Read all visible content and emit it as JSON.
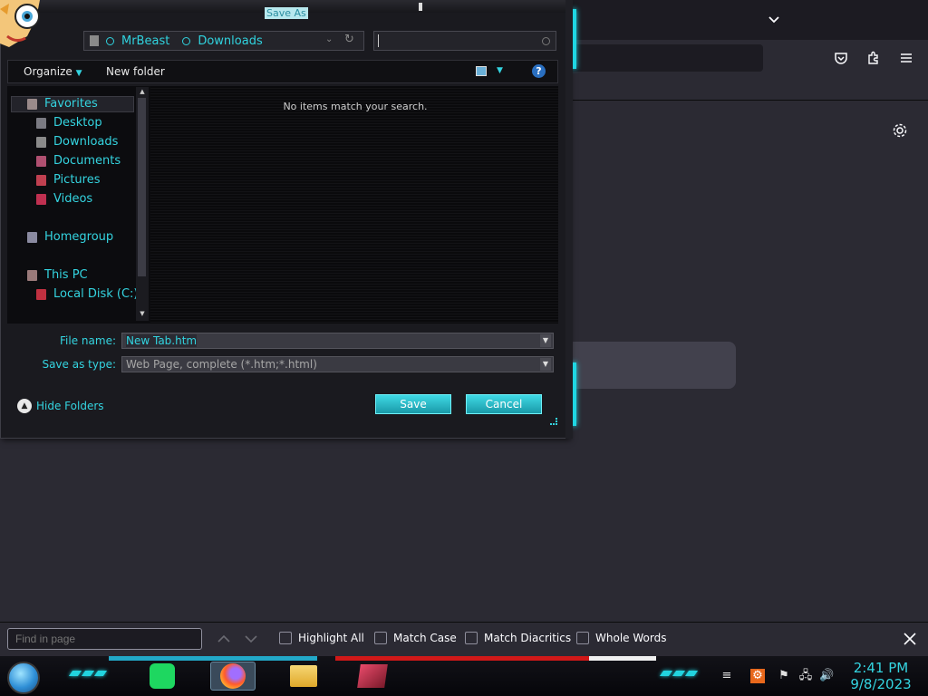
{
  "dialog": {
    "title": "Save As",
    "breadcrumb": [
      "MrBeast",
      "Downloads"
    ],
    "toolbar": {
      "organize": "Organize",
      "new_folder": "New folder"
    },
    "nav": {
      "favorites": "Favorites",
      "items": [
        "Desktop",
        "Downloads",
        "Documents",
        "Pictures",
        "Videos"
      ],
      "homegroup": "Homegroup",
      "this_pc": "This PC",
      "local_disk": "Local Disk (C:)"
    },
    "empty_message": "No items match your search.",
    "file_name_label": "File name:",
    "file_name_value": "New Tab.htm",
    "save_as_type_label": "Save as type:",
    "save_as_type_value": "Web Page, complete (*.htm;*.html)",
    "hide_folders": "Hide Folders",
    "save_button": "Save",
    "cancel_button": "Cancel"
  },
  "findbar": {
    "placeholder": "Find in page",
    "highlight_all": "Highlight All",
    "match_case": "Match Case",
    "match_diacritics": "Match Diacritics",
    "whole_words": "Whole Words"
  },
  "taskbar": {
    "time": "2:41 PM",
    "date": "9/8/2023"
  },
  "icons": [
    "chevron-down-icon",
    "pocket-icon",
    "extensions-icon",
    "menu-icon",
    "settings-icon",
    "close-icon",
    "up-arrow-icon",
    "down-arrow-icon",
    "help-icon",
    "refresh-icon"
  ],
  "colors": {
    "accent": "#34d4e0",
    "firefox_bg": "#2b2a33"
  }
}
